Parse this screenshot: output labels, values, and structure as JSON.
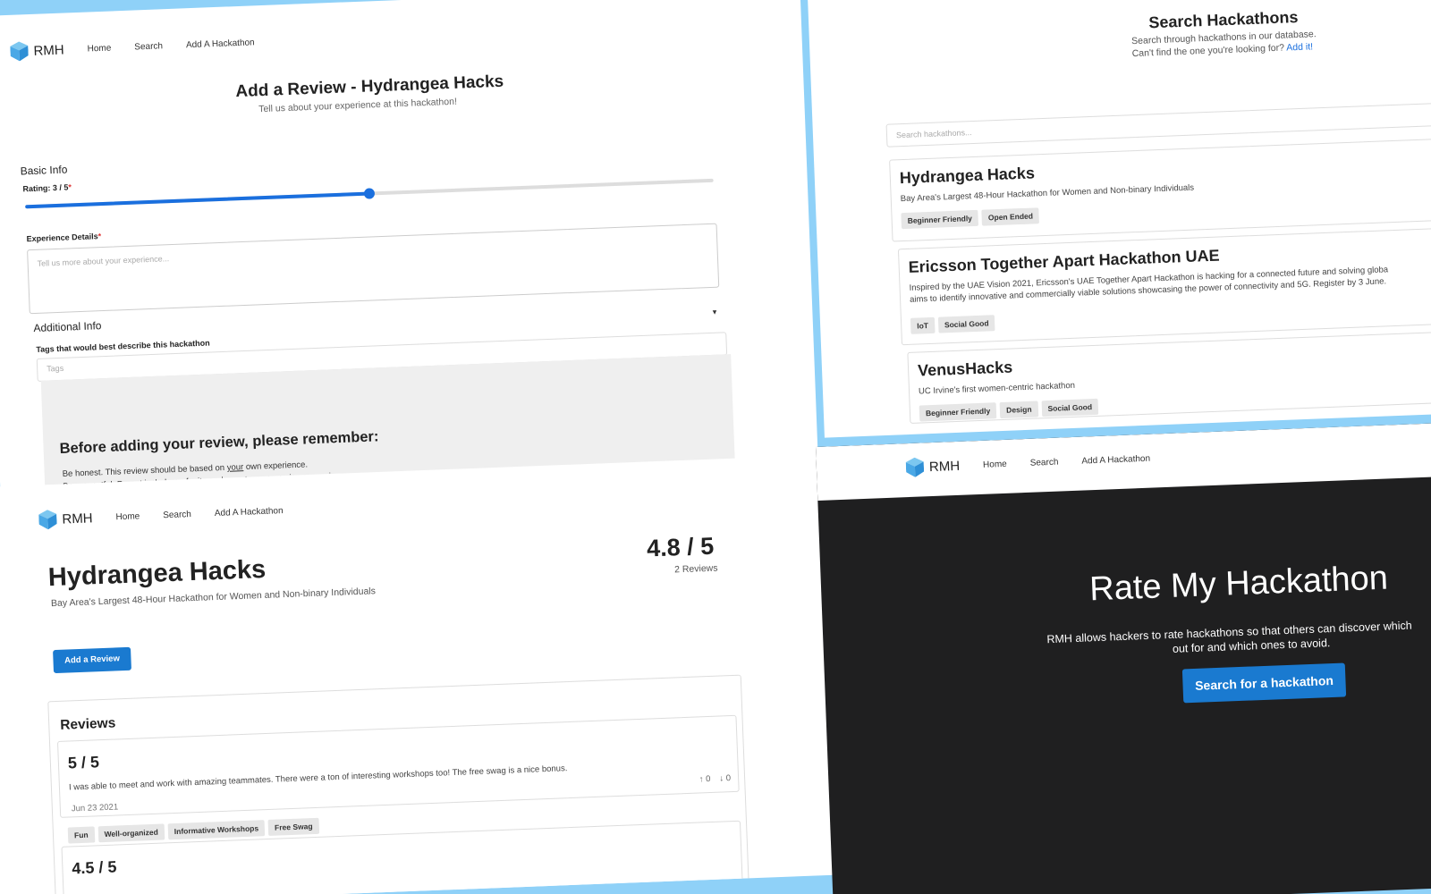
{
  "nav": {
    "logo_text": "RMH",
    "home": "Home",
    "search": "Search",
    "add": "Add A Hackathon",
    "add_alt": "Add A Hackathon"
  },
  "add_review": {
    "title": "Add a Review - Hydrangea Hacks",
    "subtitle": "Tell us about your experience at this hackathon!",
    "basic_info": "Basic Info",
    "rating_label": "Rating: 3 / 5",
    "rating_fraction": 0.5,
    "experience_label": "Experience Details",
    "experience_placeholder": "Tell us more about your experience...",
    "additional_info": "Additional Info",
    "tags_label": "Tags that would best describe this hackathon",
    "tags_placeholder": "Tags",
    "notice_title": "Before adding your review, please remember:",
    "notice_line1_a": "Be honest. This review should be based on ",
    "notice_line1_u": "your",
    "notice_line1_b": " own experience.",
    "notice_line2": "Be respectful. Do not include profanity or derogatory names in your review."
  },
  "search": {
    "title": "Search Hackathons",
    "subtitle1": "Search through hackathons in our database.",
    "subtitle2": "Can't find the one you're looking for?",
    "add_link": "Add it!",
    "placeholder": "Search hackathons...",
    "results": [
      {
        "name": "Hydrangea Hacks",
        "desc": "Bay Area's Largest 48-Hour Hackathon for Women and Non-binary Individuals",
        "tags": [
          "Beginner Friendly",
          "Open Ended"
        ]
      },
      {
        "name": "Ericsson Together Apart Hackathon UAE",
        "desc1": "Inspired by the UAE Vision 2021, Ericsson's UAE Together Apart Hackathon is hacking for a connected future and solving globa",
        "desc2": "aims to identify innovative and commercially viable solutions showcasing the power of connectivity and 5G. Register by 3 June.",
        "tags": [
          "IoT",
          "Social Good"
        ]
      },
      {
        "name": "VenusHacks",
        "desc": "UC Irvine's first women-centric hackathon",
        "tags": [
          "Beginner Friendly",
          "Design",
          "Social Good"
        ]
      }
    ]
  },
  "detail": {
    "title": "Hydrangea Hacks",
    "subtitle": "Bay Area's Largest 48-Hour Hackathon for Women and Non-binary Individuals",
    "score": "4.8 / 5",
    "count": "2 Reviews",
    "add_review_button": "Add a Review",
    "reviews_heading": "Reviews",
    "reviews": [
      {
        "score": "5 / 5",
        "text": "I was able to meet and work with amazing teammates. There were a ton of interesting workshops too! The free swag is a nice bonus.",
        "date": "Jun 23 2021",
        "up": "0",
        "down": "0",
        "tags": [
          "Fun",
          "Well-organized",
          "Informative Workshops",
          "Free Swag"
        ]
      },
      {
        "score": "4.5 / 5"
      }
    ]
  },
  "landing": {
    "title": "Rate My Hackathon",
    "text1": "RMH allows hackers to rate hackathons so that others can discover which",
    "text2": "out for and which ones to avoid.",
    "button": "Search for a hackathon"
  },
  "colors": {
    "accent": "#1a7ad0",
    "background": "#8fd1f8",
    "landing_bg": "#1f1f20"
  }
}
